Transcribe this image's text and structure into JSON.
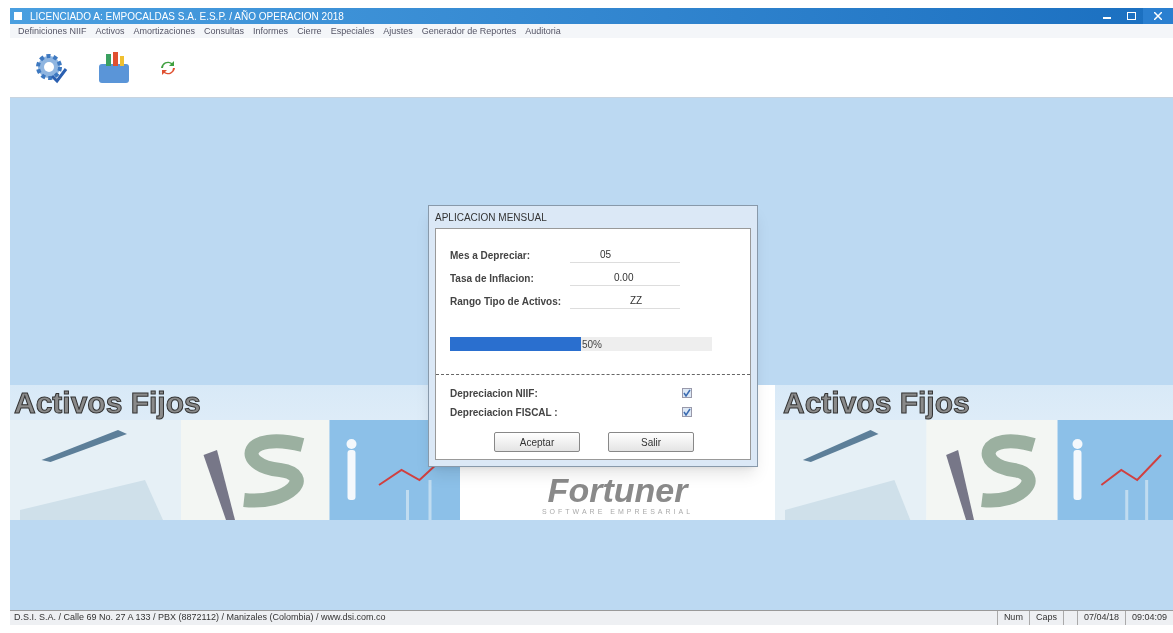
{
  "window": {
    "title": "LICENCIADO A: EMPOCALDAS S.A. E.S.P. / AÑO OPERACION 2018"
  },
  "menu": [
    "Definiciones NIIF",
    "Activos",
    "Amortizaciones",
    "Consultas",
    "Informes",
    "Cierre",
    "Especiales",
    "Ajustes",
    "Generador de Reportes",
    "Auditoria"
  ],
  "banner": {
    "title_left": "Activos Fijos",
    "title_right": "Activos Fijos",
    "logo": "Fortuner",
    "logo_tagline": "SOFTWARE EMPRESARIAL"
  },
  "dialog": {
    "title": "APLICACION MENSUAL",
    "fields": [
      {
        "label": "Mes a Depreciar:",
        "value": "05"
      },
      {
        "label": "Tasa de Inflacion:",
        "value": "0.00"
      },
      {
        "label": "Rango Tipo de Activos:",
        "value": "ZZ"
      }
    ],
    "progress": {
      "level": 0.5,
      "reading": "50%"
    },
    "options": [
      {
        "label": "Depreciacion NIIF:",
        "checked": true
      },
      {
        "label": "Depreciacion FISCAL :",
        "checked": true
      }
    ],
    "buttons": [
      "Aceptar",
      "Salir"
    ]
  },
  "status_bar": {
    "address": "D.S.I. S.A. / Calle 69 No. 27 A 133 / PBX (8872112) / Manizales (Colombia) / www.dsi.com.co",
    "indicators": [
      "Num",
      "Caps"
    ],
    "date": "07/04/18",
    "time": "09:04:09"
  }
}
